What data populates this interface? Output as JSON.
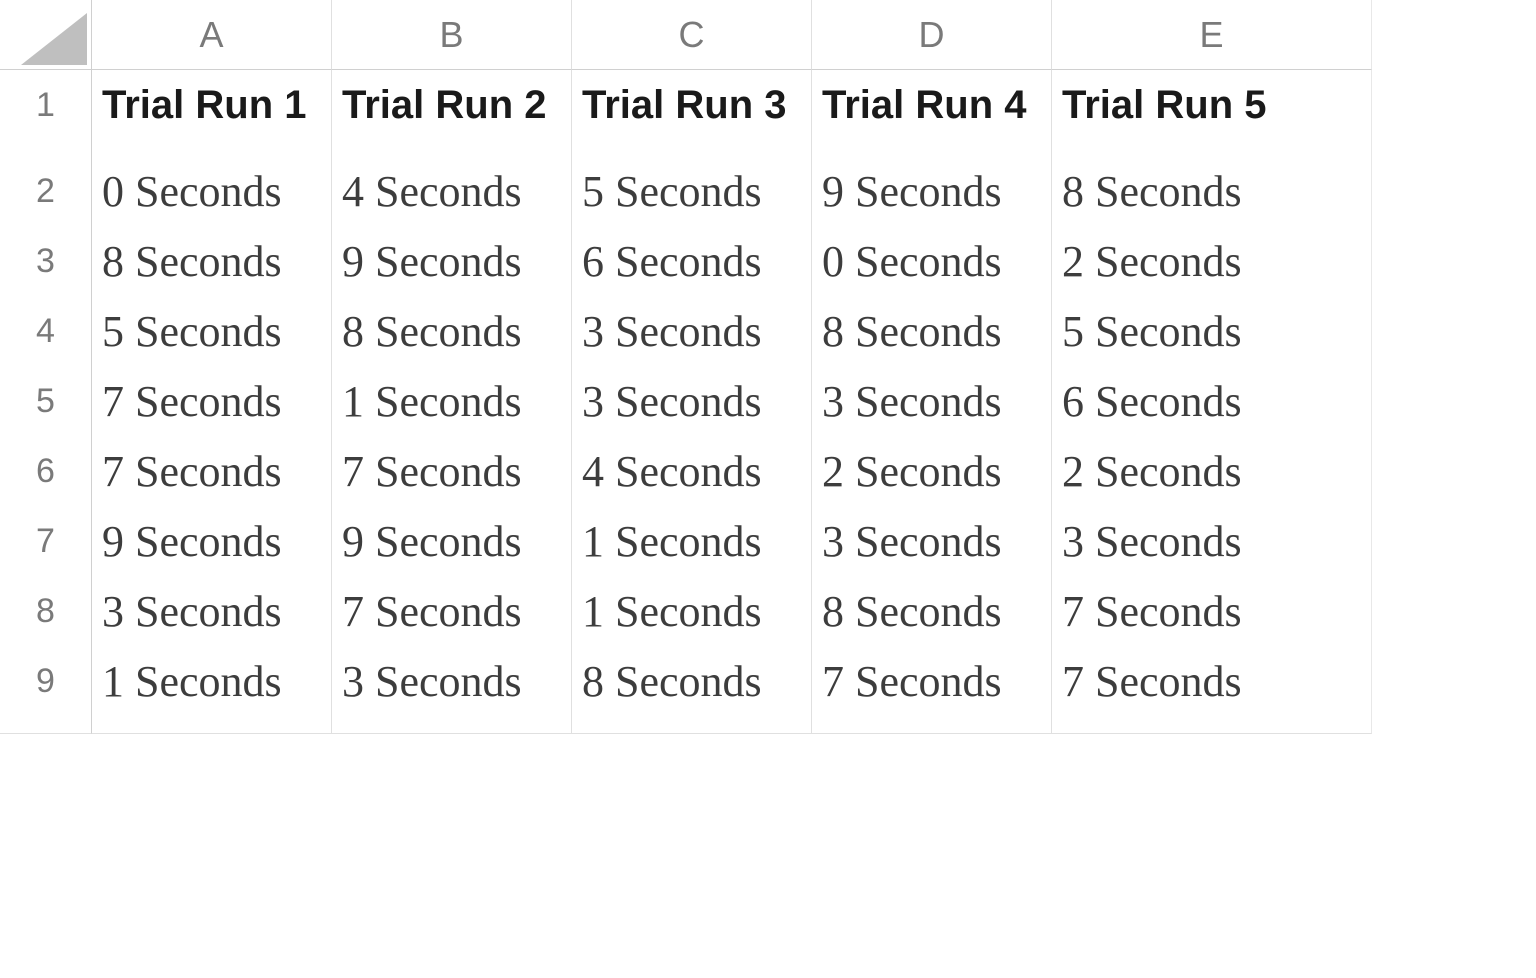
{
  "columns": [
    "A",
    "B",
    "C",
    "D",
    "E"
  ],
  "row_numbers": [
    "1",
    "2",
    "3",
    "4",
    "5",
    "6",
    "7",
    "8",
    "9"
  ],
  "headers": {
    "A": "Trial Run 1",
    "B": "Trial Run 2",
    "C": "Trial Run 3",
    "D": "Trial Run 4",
    "E": "Trial Run 5"
  },
  "rows": [
    {
      "A": "0 Seconds",
      "B": "4 Seconds",
      "C": "5 Seconds",
      "D": "9 Seconds",
      "E": "8 Seconds"
    },
    {
      "A": "8 Seconds",
      "B": "9 Seconds",
      "C": "6 Seconds",
      "D": "0 Seconds",
      "E": "2 Seconds"
    },
    {
      "A": "5 Seconds",
      "B": "8 Seconds",
      "C": "3 Seconds",
      "D": "8 Seconds",
      "E": "5 Seconds"
    },
    {
      "A": "7 Seconds",
      "B": "1 Seconds",
      "C": "3 Seconds",
      "D": "3 Seconds",
      "E": "6 Seconds"
    },
    {
      "A": "7 Seconds",
      "B": "7 Seconds",
      "C": "4 Seconds",
      "D": "2 Seconds",
      "E": "2 Seconds"
    },
    {
      "A": "9 Seconds",
      "B": "9 Seconds",
      "C": "1 Seconds",
      "D": "3 Seconds",
      "E": "3 Seconds"
    },
    {
      "A": "3 Seconds",
      "B": "7 Seconds",
      "C": "1 Seconds",
      "D": "8 Seconds",
      "E": "7 Seconds"
    },
    {
      "A": "1 Seconds",
      "B": "3 Seconds",
      "C": "8 Seconds",
      "D": "7 Seconds",
      "E": "7 Seconds"
    }
  ]
}
